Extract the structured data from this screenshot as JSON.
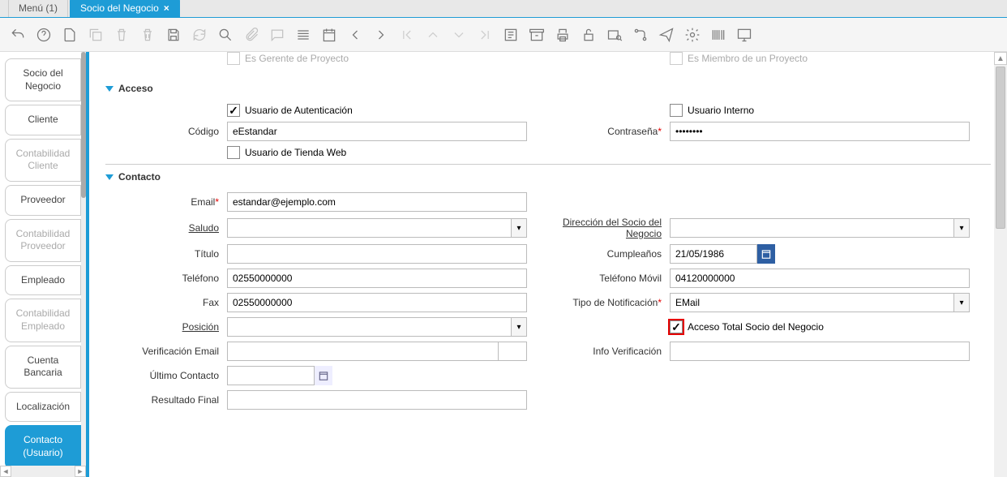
{
  "tabs": [
    {
      "label": "Menú (1)",
      "active": false
    },
    {
      "label": "Socio del Negocio",
      "active": true,
      "closable": true
    }
  ],
  "sidebar": {
    "items": [
      {
        "label": "Socio del Negocio",
        "disabled": false
      },
      {
        "label": "Cliente",
        "disabled": false
      },
      {
        "label": "Contabilidad Cliente",
        "disabled": true
      },
      {
        "label": "Proveedor",
        "disabled": false
      },
      {
        "label": "Contabilidad Proveedor",
        "disabled": true
      },
      {
        "label": "Empleado",
        "disabled": false
      },
      {
        "label": "Contabilidad Empleado",
        "disabled": true
      },
      {
        "label": "Cuenta Bancaria",
        "disabled": false
      },
      {
        "label": "Localización",
        "disabled": false
      },
      {
        "label": "Contacto (Usuario)",
        "disabled": false,
        "active": true
      }
    ]
  },
  "top_cut": {
    "left": "Es Gerente de Proyecto",
    "right": "Es Miembro de un Proyecto"
  },
  "acceso": {
    "title": "Acceso",
    "usuario_autenticacion": {
      "label": "Usuario de Autenticación",
      "checked": true
    },
    "usuario_interno": {
      "label": "Usuario Interno",
      "checked": false
    },
    "codigo": {
      "label": "Código",
      "value": "eEstandar"
    },
    "contrasena": {
      "label": "Contraseña",
      "value": "••••••••"
    },
    "usuario_tienda_web": {
      "label": "Usuario de Tienda Web",
      "checked": false
    }
  },
  "contacto": {
    "title": "Contacto",
    "email": {
      "label": "Email",
      "value": "estandar@ejemplo.com"
    },
    "saludo": {
      "label": "Saludo",
      "value": ""
    },
    "direccion_socio": {
      "label": "Dirección del Socio del Negocio",
      "value": ""
    },
    "titulo": {
      "label": "Título",
      "value": ""
    },
    "cumpleanos": {
      "label": "Cumpleaños",
      "value": "21/05/1986"
    },
    "telefono": {
      "label": "Teléfono",
      "value": "02550000000"
    },
    "telefono_movil": {
      "label": "Teléfono Móvil",
      "value": "04120000000"
    },
    "fax": {
      "label": "Fax",
      "value": "02550000000"
    },
    "tipo_notificacion": {
      "label": "Tipo de Notificación",
      "value": "EMail"
    },
    "posicion": {
      "label": "Posición",
      "value": ""
    },
    "acceso_total": {
      "label": "Acceso Total Socio del Negocio",
      "checked": true,
      "highlight": true
    },
    "verificacion_email": {
      "label": "Verificación Email"
    },
    "info_verificacion": {
      "label": "Info Verificación",
      "value": ""
    },
    "ultimo_contacto": {
      "label": "Último Contacto",
      "value": ""
    },
    "resultado_final": {
      "label": "Resultado Final",
      "value": ""
    }
  }
}
